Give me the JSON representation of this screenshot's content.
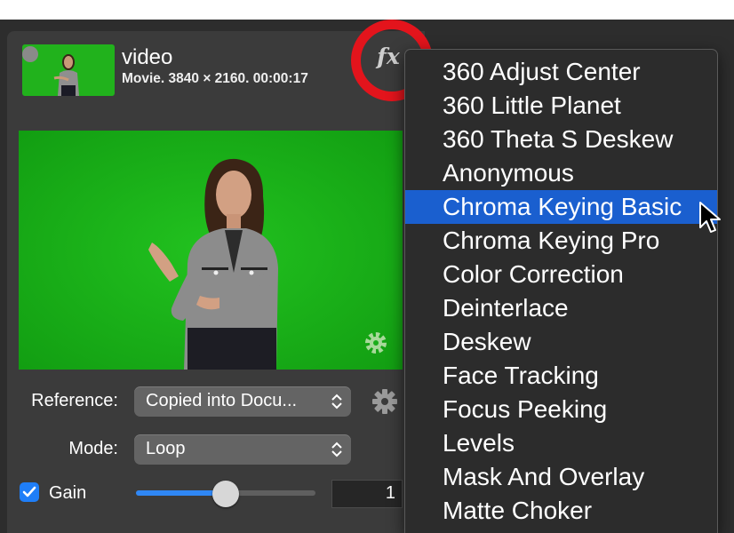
{
  "source": {
    "title": "video",
    "meta": "Movie. 3840 × 2160. 00:00:17"
  },
  "fx_button": {
    "label": "fx"
  },
  "fields": {
    "reference": {
      "label": "Reference:",
      "value": "Copied into Docu..."
    },
    "mode": {
      "label": "Mode:",
      "value": "Loop"
    },
    "gain": {
      "label": "Gain",
      "checked": true,
      "slider_level": 0.5,
      "value": "1"
    }
  },
  "fx_menu": {
    "items": [
      {
        "label": "360 Adjust Center"
      },
      {
        "label": "360 Little Planet"
      },
      {
        "label": "360 Theta S Deskew"
      },
      {
        "label": "Anonymous"
      },
      {
        "label": "Chroma Keying Basic",
        "highlighted": true
      },
      {
        "label": "Chroma Keying Pro"
      },
      {
        "label": "Color Correction"
      },
      {
        "label": "Deinterlace"
      },
      {
        "label": "Deskew"
      },
      {
        "label": "Face Tracking"
      },
      {
        "label": "Focus Peeking"
      },
      {
        "label": "Levels"
      },
      {
        "label": "Mask And Overlay"
      },
      {
        "label": "Matte Choker"
      }
    ]
  },
  "colors": {
    "accent": "#1f7ef8",
    "highlight": "#1a5fcf",
    "annotation_ring": "#e3141c",
    "green_screen": "#19b51c"
  }
}
